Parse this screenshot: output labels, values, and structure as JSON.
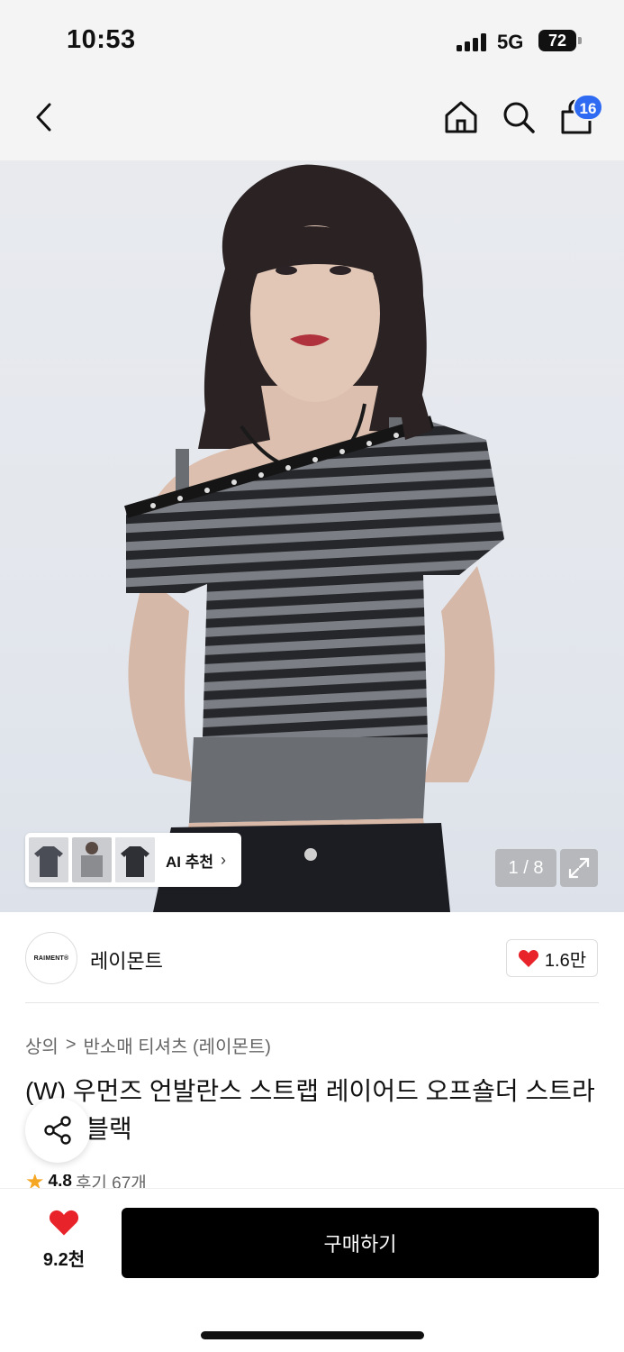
{
  "status_bar": {
    "time": "10:53",
    "network": "5G",
    "battery": "72"
  },
  "nav": {
    "cart_count": "16"
  },
  "gallery": {
    "ai_label": "AI 추천",
    "counter": "1 / 8"
  },
  "brand": {
    "logo_text": "RAIMENT®",
    "name": "레이몬트",
    "likes": "1.6만"
  },
  "breadcrumb": {
    "category": "상의",
    "separator": ">",
    "subcategory": "반소매 티셔츠 (레이몬트)"
  },
  "product": {
    "title": "(W) 우먼즈 언발란스 스트랩 레이어드 오프숄더 스트라이프_블랙",
    "rating": "4.8",
    "reviews": "후기 67개"
  },
  "bottom": {
    "wish_count": "9.2천",
    "buy_label": "구매하기"
  },
  "colors": {
    "badge": "#2f6bf2",
    "heart": "#e8232a",
    "star": "#f5a623",
    "buy": "#000000"
  }
}
